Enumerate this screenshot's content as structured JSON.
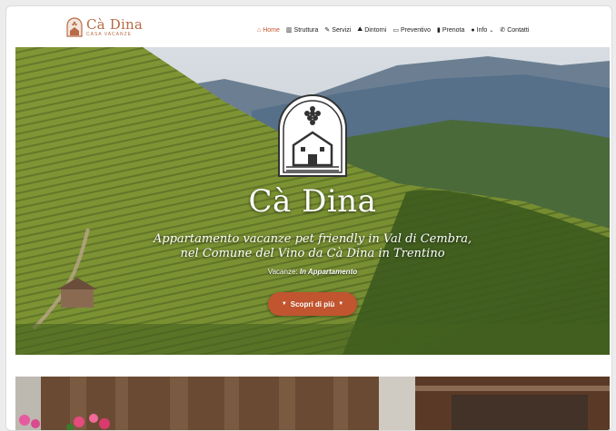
{
  "logo": {
    "name": "Cà Dina",
    "sub": "CASA VACANZE",
    "icon": "house-grape-logo"
  },
  "nav": [
    {
      "label": "Home",
      "icon": "house-icon",
      "active": true
    },
    {
      "label": "Struttura",
      "icon": "building-icon"
    },
    {
      "label": "Servizi",
      "icon": "tools-icon"
    },
    {
      "label": "Dintorni",
      "icon": "hiking-icon"
    },
    {
      "label": "Preventivo",
      "icon": "chat-icon"
    },
    {
      "label": "Prenota",
      "icon": "bookmark-icon"
    },
    {
      "label": "Info",
      "icon": "info-icon",
      "dropdown": true
    },
    {
      "label": "Contatti",
      "icon": "phone-icon"
    }
  ],
  "hero": {
    "title": "Cà Dina",
    "tagline_line1": "Appartamento vacanze pet friendly in Val di Cembra,",
    "tagline_line2": "nel Comune del Vino da Cà Dina in Trentino",
    "sub_prefix": "Vacanze",
    "sub_emph": "In Appartamento",
    "cta_label": "Scopri di più"
  },
  "colors": {
    "accent": "#c0552f",
    "logo": "#b76a44"
  }
}
